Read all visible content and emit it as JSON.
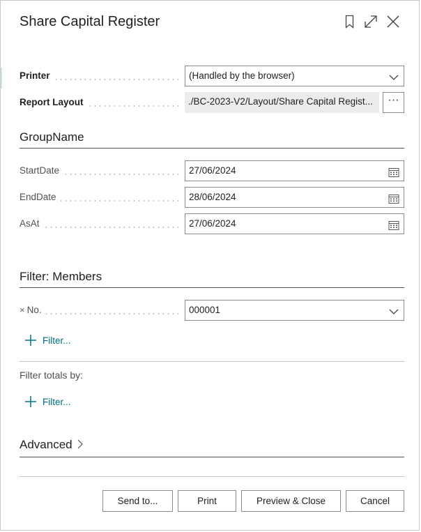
{
  "dialog": {
    "title": "Share Capital Register",
    "header_icons": [
      "bookmark-icon",
      "expand-icon",
      "close-icon"
    ]
  },
  "options": {
    "printer": {
      "label": "Printer",
      "value": "(Handled by the browser)"
    },
    "report_layout": {
      "label": "Report Layout",
      "value": "./BC-2023-V2/Layout/Share Capital Regist...",
      "more_label": "···"
    }
  },
  "group": {
    "heading": "GroupName",
    "fields": [
      {
        "label": "StartDate",
        "value": "27/06/2024"
      },
      {
        "label": "EndDate",
        "value": "28/06/2024"
      },
      {
        "label": "AsAt",
        "value": "27/06/2024"
      }
    ]
  },
  "filter_members": {
    "heading": "Filter: Members",
    "remove_symbol": "×",
    "field_label": "No.",
    "field_value": "000001",
    "add_filter_label": "Filter..."
  },
  "filter_totals": {
    "label": "Filter totals by:",
    "add_filter_label": "Filter..."
  },
  "advanced": {
    "heading": "Advanced"
  },
  "footer": {
    "send_to": "Send to...",
    "print": "Print",
    "preview_close": "Preview & Close",
    "cancel": "Cancel"
  },
  "colors": {
    "accent": "#00707a",
    "field_border": "#8a8a8a",
    "readonly_bg": "#ececec"
  }
}
